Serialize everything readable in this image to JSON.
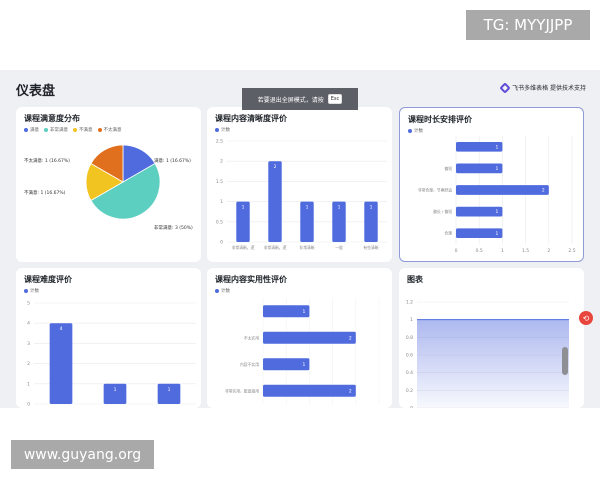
{
  "watermark_top": "TG: MYYJJPP",
  "watermark_bottom": "www.guyang.org",
  "page_title": "仪表盘",
  "powered_by": "飞书多维表格 提供技术支持",
  "toast": {
    "text": "若要退出全屏模式，请按",
    "key": "Esc"
  },
  "colors": {
    "bar": "#4f6bde",
    "pie": [
      "#4f6bde",
      "#5ccfc0",
      "#f2c422",
      "#e0701e"
    ]
  },
  "cards": {
    "satisfaction": {
      "title": "课程满意度分布",
      "legend": [
        "满意",
        "非常满意",
        "不满意",
        "不太满意"
      ],
      "labels": {
        "right": "满意: 1 (16.67%)",
        "left_top": "不太满意: 1 (16.67%)",
        "left_mid": "不满意: 1 (16.67%)",
        "bottom": "非常满意: 3 (50%)"
      }
    },
    "clarity": {
      "title": "课程内容清晰度评价",
      "legend": "计数"
    },
    "time": {
      "title": "课程时长安排评价",
      "legend": "计数"
    },
    "difficulty": {
      "title": "课程难度评价",
      "legend": "计数"
    },
    "practical": {
      "title": "课程内容实用性评价",
      "legend": "计数"
    },
    "chart": {
      "title": "图表"
    }
  },
  "chart_data": [
    {
      "type": "pie",
      "title": "课程满意度分布",
      "categories": [
        "满意",
        "非常满意",
        "不满意",
        "不太满意"
      ],
      "values": [
        1,
        3,
        1,
        1
      ],
      "percent": [
        "16.67%",
        "50%",
        "16.67%",
        "16.67%"
      ]
    },
    {
      "type": "bar",
      "title": "课程内容清晰度评价",
      "categories": [
        "非常清晰，逻辑很强",
        "非常清晰，逻辑很强",
        "非常清晰",
        "一般",
        "有些清晰"
      ],
      "series": [
        {
          "name": "计数",
          "values": [
            1,
            2,
            1,
            1,
            1
          ]
        }
      ],
      "yticks": [
        "0",
        "0.5",
        "1",
        "1.5",
        "2",
        "2.5"
      ],
      "ylim": [
        0,
        2.5
      ]
    },
    {
      "type": "bar",
      "orientation": "horizontal",
      "title": "课程时长安排评价",
      "categories": [
        "",
        "偏短",
        "非常合理，节奏舒适",
        "偏长 / 偏短",
        "合理"
      ],
      "series": [
        {
          "name": "计数",
          "values": [
            1,
            1,
            2,
            1,
            1
          ]
        }
      ],
      "xticks": [
        "0",
        "0.5",
        "1",
        "1.5",
        "2",
        "2.5"
      ],
      "xlim": [
        0,
        2.5
      ]
    },
    {
      "type": "bar",
      "title": "课程难度评价",
      "categories": [
        "",
        "",
        ""
      ],
      "series": [
        {
          "name": "计数",
          "values": [
            4,
            1,
            1
          ]
        }
      ],
      "yticks": [
        "0",
        "1",
        "2",
        "3",
        "4",
        "5"
      ],
      "ylim": [
        0,
        5
      ]
    },
    {
      "type": "bar",
      "orientation": "horizontal",
      "title": "课程内容实用性评价",
      "categories": [
        "",
        "不太实用",
        "内容不实用",
        "非常实用，能直接用"
      ],
      "series": [
        {
          "name": "计数",
          "values": [
            1,
            2,
            1,
            2
          ]
        }
      ],
      "xlim": [
        0,
        2.5
      ]
    },
    {
      "type": "area",
      "title": "图表",
      "yticks": [
        "0",
        "0.2",
        "0.4",
        "0.6",
        "0.8",
        "1",
        "1.2"
      ],
      "ylim": [
        0,
        1.2
      ],
      "series": [
        {
          "name": "",
          "values": [
            1,
            1
          ]
        }
      ]
    }
  ]
}
